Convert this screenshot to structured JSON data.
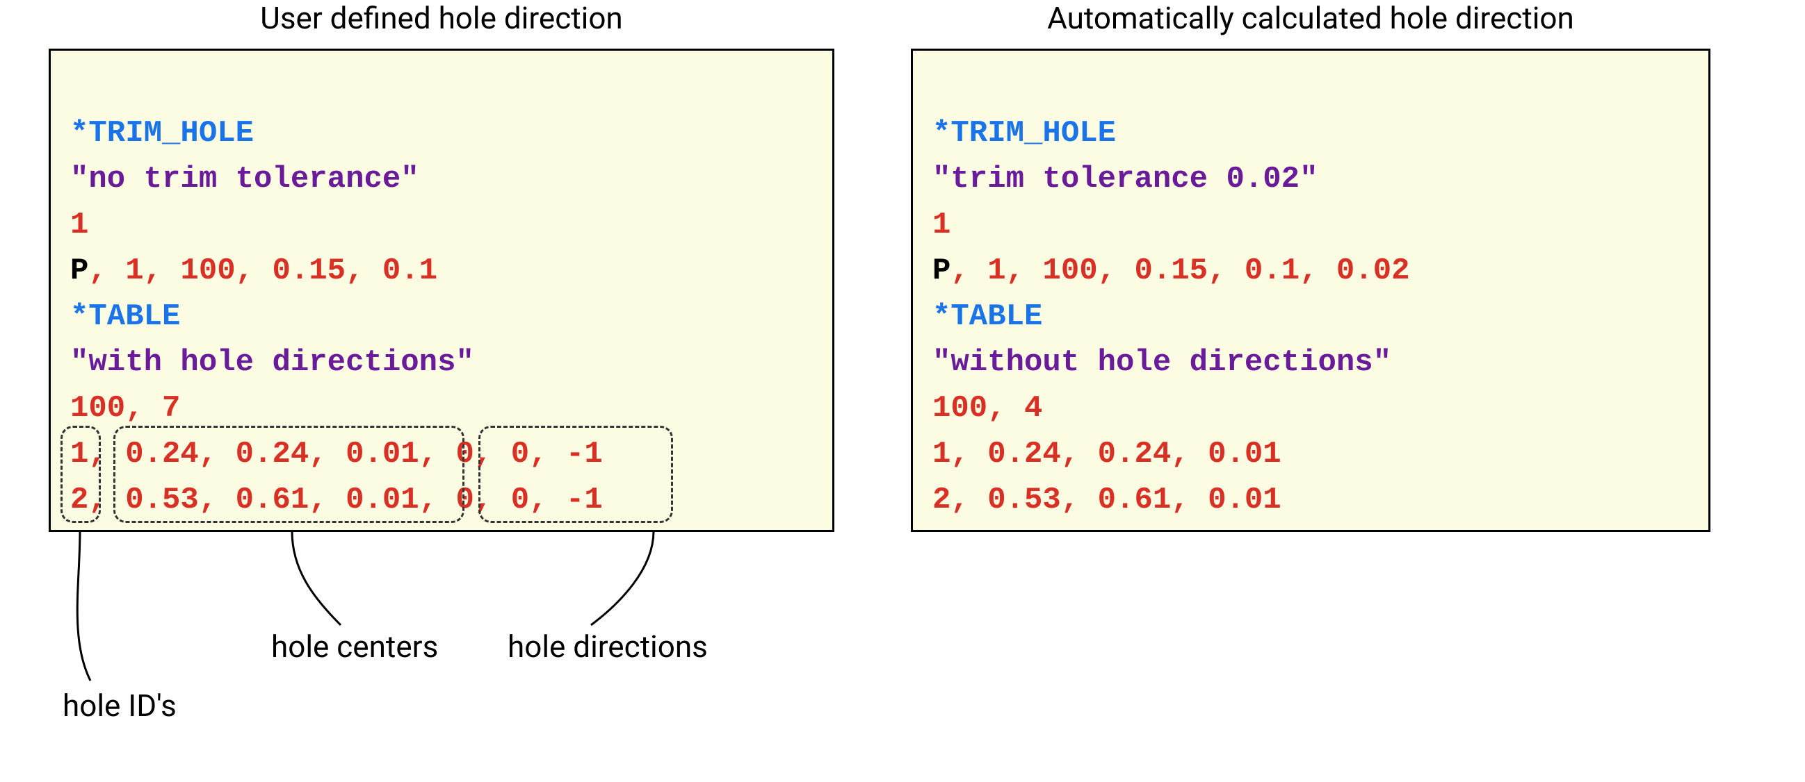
{
  "left": {
    "caption": "User defined hole direction",
    "lines": {
      "l1_kw": "*TRIM_HOLE",
      "l2_str": "\"no trim tolerance\"",
      "l3": "1",
      "l4_P": "P",
      "l4_rest_c": ", ",
      "l4_rest": "1, 100, 0.15, 0.1",
      "l5_kw": "*TABLE",
      "l6_str": "\"with hole directions\"",
      "l7": "100, 7",
      "l8_id": "1",
      "l8_c1": ",",
      "l8_cen": " 0.24, 0.24, 0.01",
      "l8_c2": ",",
      "l8_dir": " 0, 0, -1",
      "l9_id": "2",
      "l9_c1": ",",
      "l9_cen": " 0.53, 0.61, 0.01",
      "l9_c2": ",",
      "l9_dir": " 0, 0, -1"
    },
    "annotations": {
      "ids": "hole ID's",
      "centers": "hole centers",
      "dirs": "hole directions"
    }
  },
  "right": {
    "caption": "Automatically calculated hole direction",
    "lines": {
      "l1_kw": "*TRIM_HOLE",
      "l2_str": "\"trim tolerance 0.02\"",
      "l3": "1",
      "l4_P": "P",
      "l4_rest_c": ", ",
      "l4_rest": "1, 100, 0.15, 0.1, 0.02",
      "l5_kw": "*TABLE",
      "l6_str": "\"without hole directions\"",
      "l7": "100, 4",
      "l8": "1, 0.24, 0.24, 0.01",
      "l9": "2, 0.53, 0.61, 0.01"
    }
  }
}
